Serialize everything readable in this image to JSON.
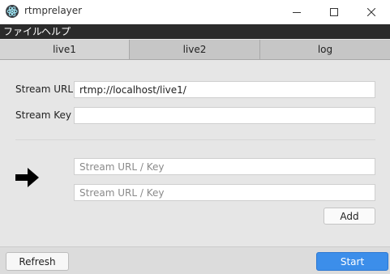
{
  "window": {
    "title": "rtmprelayer",
    "app_icon": "electron-icon",
    "controls": [
      "minimize-icon",
      "maximize-icon",
      "close-icon"
    ]
  },
  "menu": {
    "file": "ファイル",
    "help": "ヘルプ"
  },
  "tabs": [
    {
      "label": "live1",
      "active": true
    },
    {
      "label": "live2",
      "active": false
    },
    {
      "label": "log",
      "active": false
    }
  ],
  "form": {
    "stream_url_label": "Stream URL",
    "stream_url_value": "rtmp://localhost/live1/",
    "stream_key_label": "Stream Key",
    "stream_key_value": ""
  },
  "relay": {
    "arrow_icon": "arrow-right-icon",
    "targets": [
      {
        "placeholder": "Stream URL / Key",
        "value": ""
      },
      {
        "placeholder": "Stream URL / Key",
        "value": ""
      }
    ],
    "add_label": "Add"
  },
  "footer": {
    "refresh_label": "Refresh",
    "start_label": "Start"
  },
  "colors": {
    "menubar": "#2b2b2b",
    "start_button": "#3c8eea"
  }
}
